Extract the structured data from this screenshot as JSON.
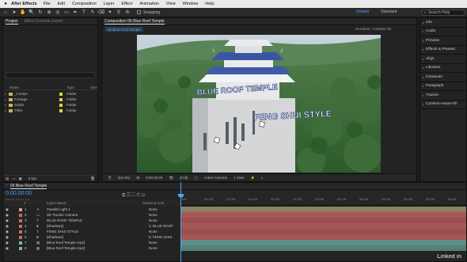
{
  "menubar": {
    "apple": "",
    "app_name": "After Effects",
    "items": [
      "File",
      "Edit",
      "Composition",
      "Layer",
      "Effect",
      "Animation",
      "View",
      "Window",
      "Help"
    ]
  },
  "toolbar": {
    "tools": [
      "⌂",
      "➤",
      "✋",
      "🔍",
      "↻",
      "⊕",
      "◎",
      "▭",
      "✒",
      "T",
      "✎",
      "⌫",
      "✦",
      "⚲",
      "✇"
    ],
    "snapping_label": "Snapping",
    "workspaces": [
      "Default",
      "Standard"
    ],
    "search_placeholder": "Search Help"
  },
  "project_panel": {
    "tab_label": "Project",
    "effect_controls_tab": "Effect Controls (none)",
    "columns": [
      "Name",
      "Type",
      "Size"
    ],
    "items": [
      {
        "name": "_Comps",
        "type": "Folder"
      },
      {
        "name": "Footage",
        "type": "Folder"
      },
      {
        "name": "Solids",
        "type": "Folder"
      },
      {
        "name": "Titles",
        "type": "Folder"
      }
    ],
    "bit_depth": "8 bpc"
  },
  "composition_panel": {
    "tab_label": "Composition 06 Blue Roof Temple",
    "comp_name_tag": "06 Blue Roof Temple",
    "renderer_label": "Renderer:",
    "renderer_value": "CINEMA 4D",
    "zoom": "(84.3%)",
    "timecode": "0:00:02:29",
    "resolution": "(Full)",
    "camera": "Active Camera",
    "views": "1 View",
    "sign_text_1": "BLUE ROOF TEMPLE",
    "sign_text_2": "FENG SHUI STYLE"
  },
  "right_panels": [
    "Info",
    "Audio",
    "Preview",
    "Effects & Presets",
    "Align",
    "Libraries",
    "Character",
    "Paragraph",
    "Tracker",
    "Content-Aware Fill"
  ],
  "timeline": {
    "tab_label": "06 Blue Roof Temple",
    "timecode": "0:00:00:00",
    "frame_info": "00000 (29.97 fps)",
    "columns": [
      "#",
      "Layer Name",
      "Parent & Link"
    ],
    "ruler_ticks": [
      "00f",
      "00:15f",
      "01:00f",
      "01:15f",
      "02:00f",
      "02:15f",
      "03:00f",
      "03:15f",
      "04:00f",
      "04:15f",
      "05:00f",
      "05:15f",
      "06:00"
    ],
    "layers": [
      {
        "num": "1",
        "name": "Parallel Light 1",
        "parent": "None",
        "color": "#c2b07a"
      },
      {
        "num": "2",
        "name": "3D Tracker Camera",
        "parent": "None",
        "color": "#c96b6b"
      },
      {
        "num": "3",
        "name": "BLUE ROOF TEMPLE",
        "parent": "None",
        "color": "#c96b6b"
      },
      {
        "num": "4",
        "name": "[Shadows]",
        "parent": "3. BLUE ROOF",
        "color": "#c96b6b"
      },
      {
        "num": "5",
        "name": "FENG SHUI STYLE",
        "parent": "None",
        "color": "#c96b6b"
      },
      {
        "num": "6",
        "name": "[Shadows]",
        "parent": "5. FENG SHUI",
        "color": "#c96b6b"
      },
      {
        "num": "7",
        "name": "[Blue Roof Temple.mp4]",
        "parent": "None",
        "color": "#7ab8b0"
      },
      {
        "num": "8",
        "name": "[Blue Roof Temple.mp4]",
        "parent": "None",
        "color": "#7ab8b0"
      }
    ],
    "watermark": "Linked in"
  }
}
